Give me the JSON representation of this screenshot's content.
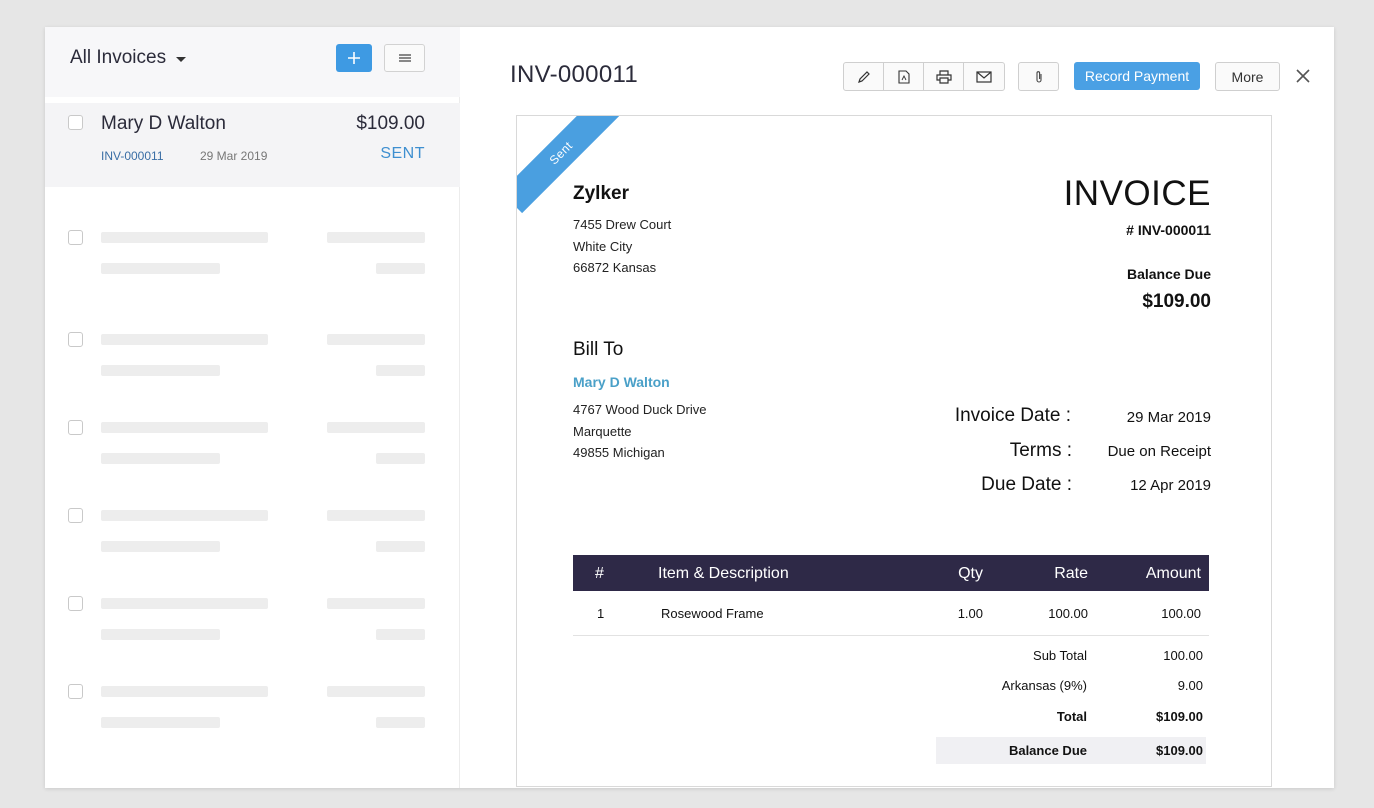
{
  "sidebar": {
    "title": "All Invoices",
    "selected": {
      "name": "Mary D Walton",
      "amount": "$109.00",
      "number": "INV-000011",
      "date": "29 Mar 2019",
      "status": "SENT"
    }
  },
  "header": {
    "invoice_id": "INV-000011",
    "record_payment_label": "Record Payment",
    "more_label": "More"
  },
  "invoice": {
    "status_ribbon": "Sent",
    "org_name": "Zylker",
    "org_address": [
      "7455 Drew Court",
      "White City",
      "66872 Kansas"
    ],
    "doc_title": "INVOICE",
    "doc_number": "# INV-000011",
    "balance_due_label": "Balance Due",
    "balance_due": "$109.00",
    "bill_to_label": "Bill To",
    "customer_name": "Mary D Walton",
    "customer_address": [
      "4767 Wood Duck Drive",
      "Marquette",
      "49855 Michigan"
    ],
    "invoice_date_label": "Invoice Date :",
    "invoice_date": "29 Mar 2019",
    "terms_label": "Terms :",
    "terms": "Due on Receipt",
    "due_date_label": "Due Date :",
    "due_date": "12 Apr 2019",
    "columns": {
      "num": "#",
      "item": "Item & Description",
      "qty": "Qty",
      "rate": "Rate",
      "amount": "Amount"
    },
    "items": [
      {
        "num": "1",
        "item": "Rosewood Frame",
        "qty": "1.00",
        "rate": "100.00",
        "amount": "100.00"
      }
    ],
    "totals": {
      "sub_total_label": "Sub Total",
      "sub_total": "100.00",
      "tax_label": "Arkansas (9%)",
      "tax": "9.00",
      "total_label": "Total",
      "total": "$109.00",
      "balance_label": "Balance Due",
      "balance": "$109.00"
    }
  },
  "colors": {
    "accent": "#4aa0e4",
    "table_header": "#2e2947",
    "link": "#4aa0c8"
  },
  "icons": [
    "chevron-down-icon",
    "plus-icon",
    "hamburger-icon",
    "pencil-icon",
    "pdf-icon",
    "print-icon",
    "mail-icon",
    "paperclip-icon",
    "close-icon"
  ]
}
